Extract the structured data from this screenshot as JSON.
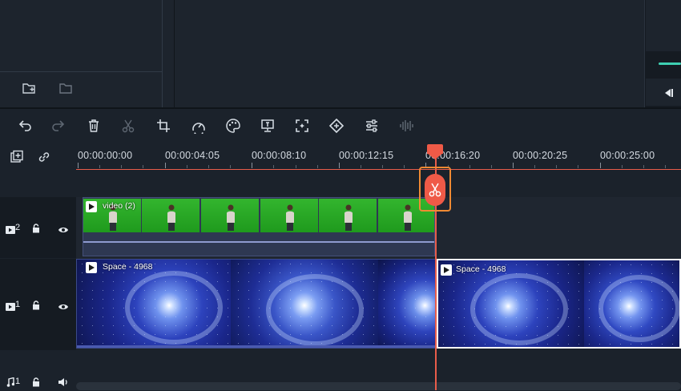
{
  "toolbar": {
    "tools": [
      "undo",
      "redo",
      "delete",
      "cut",
      "crop",
      "speed",
      "color",
      "green-screen",
      "stabilize",
      "keyframe",
      "audio-adjust",
      "audio-wave"
    ]
  },
  "ruler": {
    "timecodes": [
      "00:00:00:00",
      "00:00:04:05",
      "00:00:08:10",
      "00:00:12:15",
      "00:00:16:20",
      "00:00:20:25",
      "00:00:25:00"
    ]
  },
  "tracks": {
    "video2": {
      "number": "2",
      "clip_label": "video (2)"
    },
    "video1": {
      "number": "1",
      "clip_left_label": "Space - 4968",
      "clip_right_label": "Space - 4968"
    },
    "audio1": {
      "number": "1"
    }
  },
  "colors": {
    "playhead": "#ef5a47",
    "split_highlight": "#f08a33",
    "accent": "#3ecfb2"
  }
}
